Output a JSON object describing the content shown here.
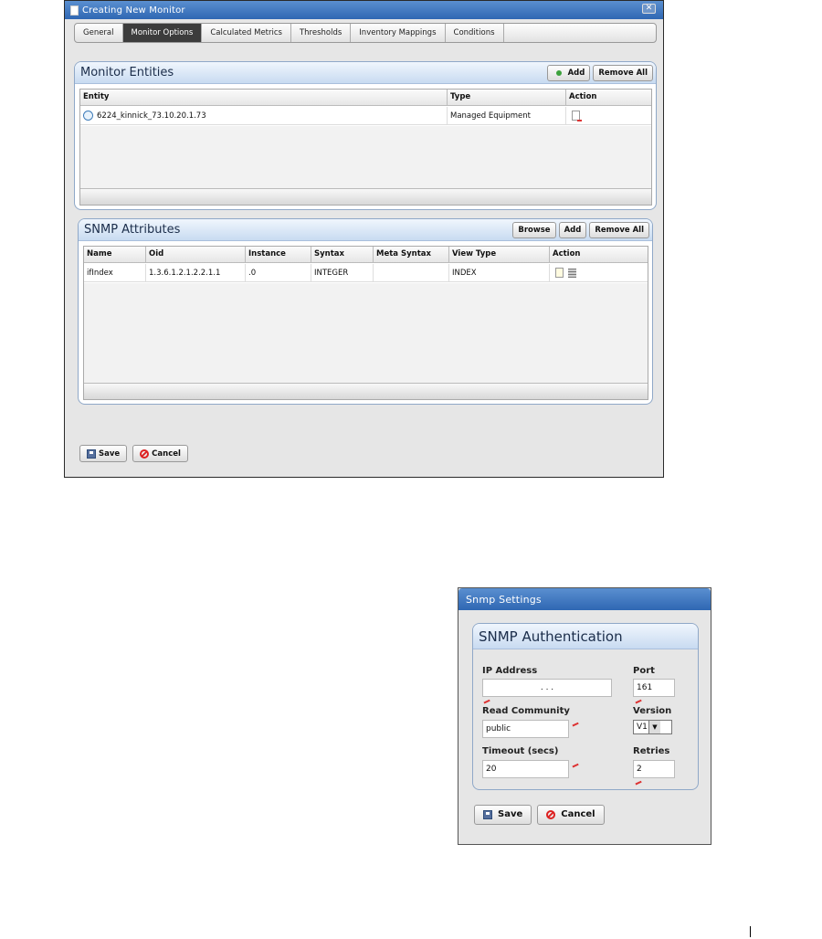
{
  "monitor_dialog": {
    "title": "Creating New Monitor",
    "close_icon": "close-icon",
    "tabs": [
      "General",
      "Monitor Options",
      "Calculated Metrics",
      "Thresholds",
      "Inventory Mappings",
      "Conditions"
    ],
    "active_tab": "Monitor Options",
    "entities": {
      "title": "Monitor Entities",
      "add_label": "Add",
      "remove_all_label": "Remove All",
      "columns": [
        "Entity",
        "Type",
        "Action"
      ],
      "rows": [
        {
          "entity": "6224_kinnick_73.10.20.1.73",
          "type": "Managed Equipment"
        }
      ]
    },
    "snmp_attributes": {
      "title": "SNMP Attributes",
      "browse_label": "Browse",
      "add_label": "Add",
      "remove_all_label": "Remove All",
      "columns": [
        "Name",
        "Oid",
        "Instance",
        "Syntax",
        "Meta Syntax",
        "View Type",
        "Action"
      ],
      "rows": [
        {
          "name": "ifIndex",
          "oid": "1.3.6.1.2.1.2.2.1.1",
          "instance": ".0",
          "syntax": "INTEGER",
          "meta_syntax": "",
          "view_type": "INDEX"
        }
      ]
    },
    "save_label": "Save",
    "cancel_label": "Cancel"
  },
  "snmp_dialog": {
    "title": "Snmp Settings",
    "panel_title": "SNMP Authentication",
    "ip_label": "IP Address",
    "ip_value": ".   .   .",
    "port_label": "Port",
    "port_value": "161",
    "community_label": "Read Community",
    "community_value": "public",
    "version_label": "Version",
    "version_value": "V1",
    "timeout_label": "Timeout (secs)",
    "timeout_value": "20",
    "retries_label": "Retries",
    "retries_value": "2",
    "save_label": "Save",
    "cancel_label": "Cancel"
  }
}
